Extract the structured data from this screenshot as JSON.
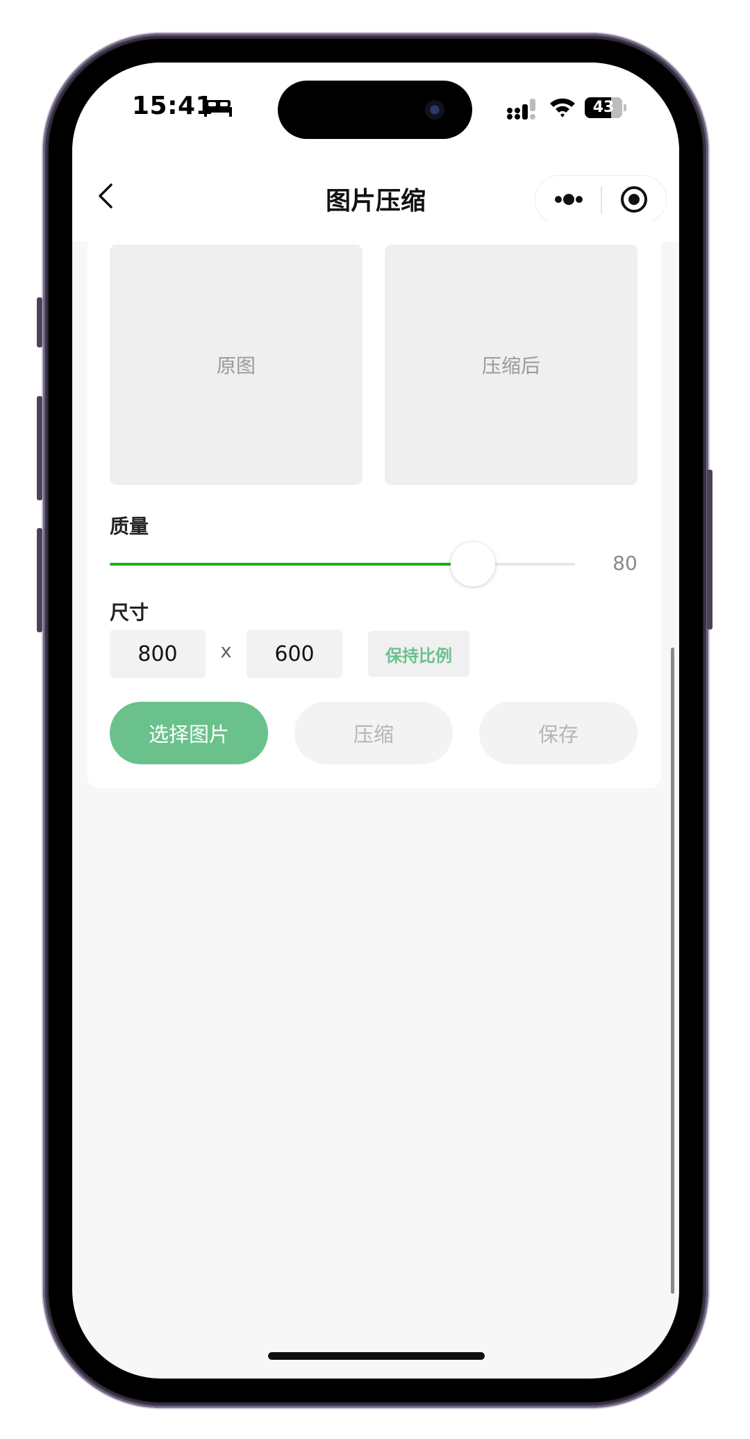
{
  "status_bar": {
    "time": "15:41",
    "battery": "43"
  },
  "nav": {
    "title": "图片压缩"
  },
  "previews": {
    "original": "原图",
    "compressed": "压缩后"
  },
  "quality": {
    "label": "质量",
    "value": "80",
    "fraction": 0.78,
    "accent_color": "#1aad19"
  },
  "size": {
    "label": "尺寸",
    "width": "800",
    "separator": "x",
    "height": "600",
    "keep_ratio": "保持比例"
  },
  "actions": {
    "select": "选择图片",
    "compress": "压缩",
    "save": "保存",
    "primary_color": "#6ac18b"
  }
}
